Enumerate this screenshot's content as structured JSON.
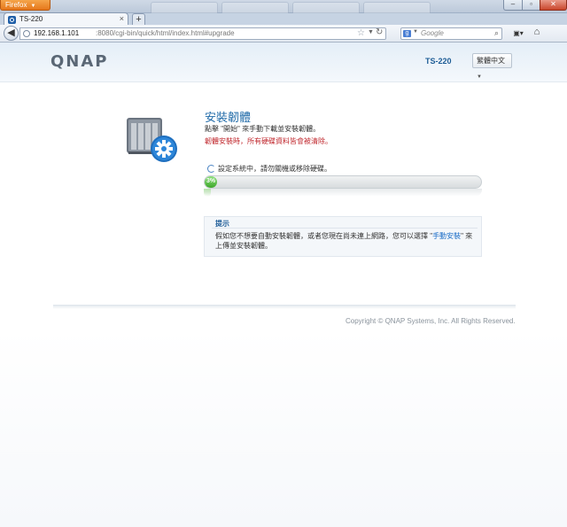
{
  "browser": {
    "app_button_label": "Firefox",
    "tab_title": "TS-220",
    "url_host": "192.168.1.101",
    "url_rest": ":8080/cgi-bin/quick/html/index.html#upgrade",
    "search_placeholder": "Google",
    "icons": [
      "back-icon",
      "globe-icon",
      "star-icon",
      "reload-icon",
      "google-icon",
      "search-icon",
      "bookmarks-icon",
      "home-icon"
    ]
  },
  "header": {
    "logo": "QNAP",
    "model": "TS-220",
    "language": "繁體中文"
  },
  "main": {
    "title": "安裝韌體",
    "description": "點擊 \"開始\" 來手動下載並安裝韌體。",
    "warning": "韌體安裝時，所有硬碟資料皆會被清除。",
    "status": "設定系統中，請勿關機或移除硬碟。",
    "progress": {
      "percent": 3,
      "label": "3%"
    }
  },
  "tip": {
    "title": "提示",
    "body_before": "假如您不想要自動安裝韌體，或者您現在尚未連上網路，您可以選擇 \"",
    "link": "手動安裝",
    "body_after": "\" 來上傳並安裝韌體。"
  },
  "footer": {
    "copyright": "Copyright © QNAP Systems, Inc. All Rights Reserved."
  },
  "colors": {
    "accent": "#1f6aa8",
    "warning": "#c0282e",
    "progress": "#3fa82b"
  }
}
